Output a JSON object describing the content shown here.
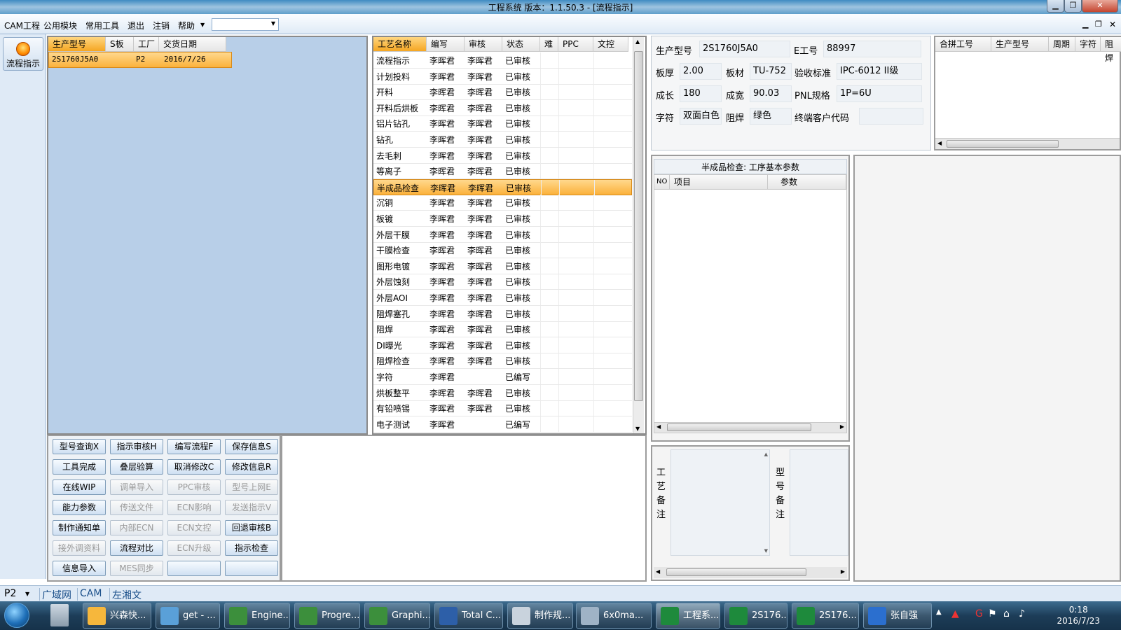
{
  "window": {
    "title": "工程系统    版本：1.1.50.3 - [流程指示]"
  },
  "menu": {
    "items": [
      "CAM工程",
      "公用模块",
      "常用工具",
      "退出",
      "注销",
      "帮助"
    ],
    "combo_value": ""
  },
  "sidebar": {
    "button_label": "流程指示"
  },
  "left_grid": {
    "headers": [
      "生产型号",
      "S板",
      "工厂",
      "交货日期"
    ],
    "rows": [
      [
        "2S1760J5A0",
        "",
        "P2",
        "2016/7/26"
      ]
    ]
  },
  "process_grid": {
    "headers": [
      "工艺名称",
      "编写",
      "审核",
      "状态",
      "难",
      "PPC",
      "文控"
    ],
    "rows": [
      [
        "流程指示",
        "李晖君",
        "李晖君",
        "已审核"
      ],
      [
        "计划投料",
        "李晖君",
        "李晖君",
        "已审核"
      ],
      [
        "开料",
        "李晖君",
        "李晖君",
        "已审核"
      ],
      [
        "开料后烘板",
        "李晖君",
        "李晖君",
        "已审核"
      ],
      [
        "铝片钻孔",
        "李晖君",
        "李晖君",
        "已审核"
      ],
      [
        "钻孔",
        "李晖君",
        "李晖君",
        "已审核"
      ],
      [
        "去毛刺",
        "李晖君",
        "李晖君",
        "已审核"
      ],
      [
        "等离子",
        "李晖君",
        "李晖君",
        "已审核"
      ],
      [
        "半成品检查",
        "李晖君",
        "李晖君",
        "已审核"
      ],
      [
        "沉铜",
        "李晖君",
        "李晖君",
        "已审核"
      ],
      [
        "板镀",
        "李晖君",
        "李晖君",
        "已审核"
      ],
      [
        "外层干膜",
        "李晖君",
        "李晖君",
        "已审核"
      ],
      [
        "干膜检查",
        "李晖君",
        "李晖君",
        "已审核"
      ],
      [
        "图形电镀",
        "李晖君",
        "李晖君",
        "已审核"
      ],
      [
        "外层蚀刻",
        "李晖君",
        "李晖君",
        "已审核"
      ],
      [
        "外层AOI",
        "李晖君",
        "李晖君",
        "已审核"
      ],
      [
        "阻焊塞孔",
        "李晖君",
        "李晖君",
        "已审核"
      ],
      [
        "阻焊",
        "李晖君",
        "李晖君",
        "已审核"
      ],
      [
        "DI曝光",
        "李晖君",
        "李晖君",
        "已审核"
      ],
      [
        "阻焊检查",
        "李晖君",
        "李晖君",
        "已审核"
      ],
      [
        "字符",
        "李晖君",
        "",
        "已编写"
      ],
      [
        "烘板整平",
        "李晖君",
        "李晖君",
        "已审核"
      ],
      [
        "有铅喷锡",
        "李晖君",
        "李晖君",
        "已审核"
      ],
      [
        "电子测试",
        "李晖君",
        "",
        "已编写"
      ]
    ]
  },
  "buttons": [
    [
      "型号查询X",
      "指示审核H",
      "编写流程F",
      "保存信息S"
    ],
    [
      "工具完成",
      "叠层验算",
      "取消修改C",
      "修改信息R"
    ],
    [
      "在线WIP",
      "调单导入",
      "PPC审核",
      "型号上网E"
    ],
    [
      "能力参数",
      "传送文件",
      "ECN影响",
      "发送指示V"
    ],
    [
      "制作通知单",
      "内部ECN",
      "ECN文控",
      "回退审核B"
    ],
    [
      "接外调资料",
      "流程对比",
      "ECN升级",
      "指示检查"
    ],
    [
      "信息导入",
      "MES同步",
      "",
      ""
    ]
  ],
  "info": {
    "model_label": "生产型号",
    "model": "2S1760J5A0",
    "eno_label": "E工号",
    "eno": "88997",
    "thickness_label": "板厚",
    "thickness": "2.00",
    "material_label": "板材",
    "material": "TU-752",
    "standard_label": "验收标准",
    "standard": "IPC-6012 II级",
    "length_label": "成长",
    "length": "180",
    "width_label": "成宽",
    "width": "90.03",
    "pnl_label": "PNL规格",
    "pnl": "1P=6U",
    "char_label": "字符",
    "char": "双面白色",
    "mask_label": "阻焊",
    "mask": "绿色",
    "customer_label": "终端客户代码",
    "customer": ""
  },
  "merge_grid": {
    "headers": [
      "合拼工号",
      "生产型号",
      "周期",
      "字符",
      "阻焊"
    ]
  },
  "param_panel": {
    "title": "半成品检查: 工序基本参数",
    "headers": [
      "NO",
      "项目",
      "参数"
    ]
  },
  "notes": {
    "process_label": "工艺备注",
    "model_label": "型号备注"
  },
  "statusbar": {
    "factory": "P2",
    "tabs": [
      "广域网",
      "CAM",
      "左湘文"
    ]
  },
  "taskbar": {
    "items": [
      "兴森快...",
      "get - ...",
      "Engine...",
      "Progre...",
      "Graphi...",
      "Total C...",
      "制作规...",
      "6x0ma...",
      "工程系...",
      "2S176...",
      "2S176...",
      "张自强"
    ],
    "time": "0:18",
    "date": "2016/7/23"
  }
}
